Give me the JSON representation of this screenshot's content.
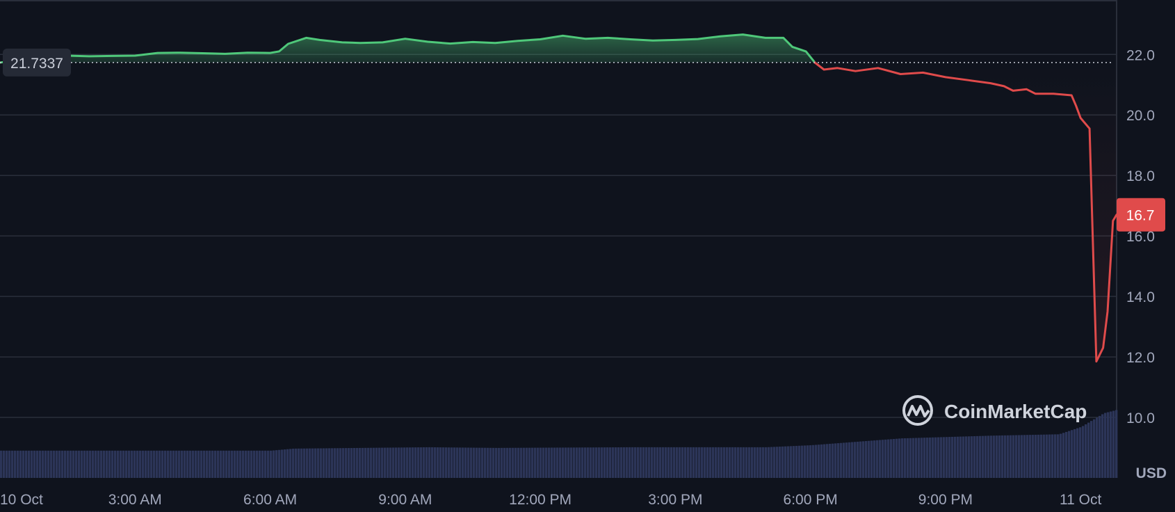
{
  "watermark": {
    "text": "CoinMarketCap",
    "icon": "coinmarketcap-logo-icon"
  },
  "colors": {
    "background": "#0f131d",
    "grid": "#2a2f3b",
    "up": "#4fc87a",
    "down": "#e04b4b",
    "volume": "#2c3558",
    "axis_text": "#a1a7bb"
  },
  "chart_data": {
    "type": "area",
    "currency_label": "USD",
    "baseline": {
      "value": 21.7337,
      "label": "21.7337"
    },
    "last_value": {
      "value": 16.7,
      "label": "16.7"
    },
    "ylim": [
      8.0,
      23.8
    ],
    "y_ticks": [
      {
        "value": 10.0,
        "label": "10.0"
      },
      {
        "value": 12.0,
        "label": "12.0"
      },
      {
        "value": 14.0,
        "label": "14.0"
      },
      {
        "value": 16.0,
        "label": "16.0"
      },
      {
        "value": 18.0,
        "label": "18.0"
      },
      {
        "value": 20.0,
        "label": "20.0"
      },
      {
        "value": 22.0,
        "label": "22.0"
      }
    ],
    "xlim": [
      0,
      24.8
    ],
    "x_ticks": [
      {
        "value": 0,
        "label": "10 Oct"
      },
      {
        "value": 3,
        "label": "3:00 AM"
      },
      {
        "value": 6,
        "label": "6:00 AM"
      },
      {
        "value": 9,
        "label": "9:00 AM"
      },
      {
        "value": 12,
        "label": "12:00 PM"
      },
      {
        "value": 15,
        "label": "3:00 PM"
      },
      {
        "value": 18,
        "label": "6:00 PM"
      },
      {
        "value": 21,
        "label": "9:00 PM"
      },
      {
        "value": 24,
        "label": "11 Oct"
      }
    ],
    "series": [
      {
        "points": [
          [
            0.0,
            21.73
          ],
          [
            0.3,
            21.8
          ],
          [
            0.8,
            21.92
          ],
          [
            1.5,
            21.96
          ],
          [
            2.0,
            21.94
          ],
          [
            2.5,
            21.95
          ],
          [
            3.0,
            21.96
          ],
          [
            3.5,
            22.05
          ],
          [
            4.0,
            22.06
          ],
          [
            4.5,
            22.04
          ],
          [
            5.0,
            22.02
          ],
          [
            5.5,
            22.06
          ],
          [
            6.0,
            22.05
          ],
          [
            6.2,
            22.1
          ],
          [
            6.4,
            22.35
          ],
          [
            6.8,
            22.55
          ],
          [
            7.1,
            22.48
          ],
          [
            7.6,
            22.4
          ],
          [
            8.0,
            22.38
          ],
          [
            8.5,
            22.4
          ],
          [
            9.0,
            22.52
          ],
          [
            9.5,
            22.42
          ],
          [
            10.0,
            22.36
          ],
          [
            10.5,
            22.41
          ],
          [
            11.0,
            22.38
          ],
          [
            11.5,
            22.45
          ],
          [
            12.0,
            22.5
          ],
          [
            12.5,
            22.62
          ],
          [
            13.0,
            22.52
          ],
          [
            13.5,
            22.55
          ],
          [
            14.0,
            22.5
          ],
          [
            14.5,
            22.46
          ],
          [
            15.0,
            22.48
          ],
          [
            15.5,
            22.51
          ],
          [
            16.0,
            22.6
          ],
          [
            16.5,
            22.66
          ],
          [
            17.0,
            22.55
          ],
          [
            17.4,
            22.55
          ],
          [
            17.6,
            22.25
          ],
          [
            17.9,
            22.1
          ],
          [
            18.1,
            21.73
          ],
          [
            18.3,
            21.5
          ],
          [
            18.6,
            21.55
          ],
          [
            19.0,
            21.45
          ],
          [
            19.5,
            21.55
          ],
          [
            20.0,
            21.35
          ],
          [
            20.5,
            21.4
          ],
          [
            21.0,
            21.25
          ],
          [
            21.5,
            21.15
          ],
          [
            22.0,
            21.05
          ],
          [
            22.3,
            20.95
          ],
          [
            22.5,
            20.8
          ],
          [
            22.8,
            20.85
          ],
          [
            23.0,
            20.7
          ],
          [
            23.4,
            20.7
          ],
          [
            23.8,
            20.65
          ],
          [
            23.9,
            20.3
          ],
          [
            24.0,
            19.9
          ],
          [
            24.2,
            19.55
          ],
          [
            24.35,
            11.85
          ],
          [
            24.5,
            12.3
          ],
          [
            24.6,
            13.5
          ],
          [
            24.72,
            16.5
          ],
          [
            24.8,
            16.7
          ]
        ]
      }
    ],
    "volume_level": [
      [
        0.0,
        0.4
      ],
      [
        6.0,
        0.4
      ],
      [
        6.5,
        0.43
      ],
      [
        9.5,
        0.45
      ],
      [
        11.0,
        0.44
      ],
      [
        14.0,
        0.45
      ],
      [
        17.0,
        0.45
      ],
      [
        18.0,
        0.48
      ],
      [
        20.0,
        0.58
      ],
      [
        22.0,
        0.62
      ],
      [
        23.5,
        0.64
      ],
      [
        24.0,
        0.75
      ],
      [
        24.5,
        0.95
      ],
      [
        24.8,
        1.0
      ]
    ]
  }
}
